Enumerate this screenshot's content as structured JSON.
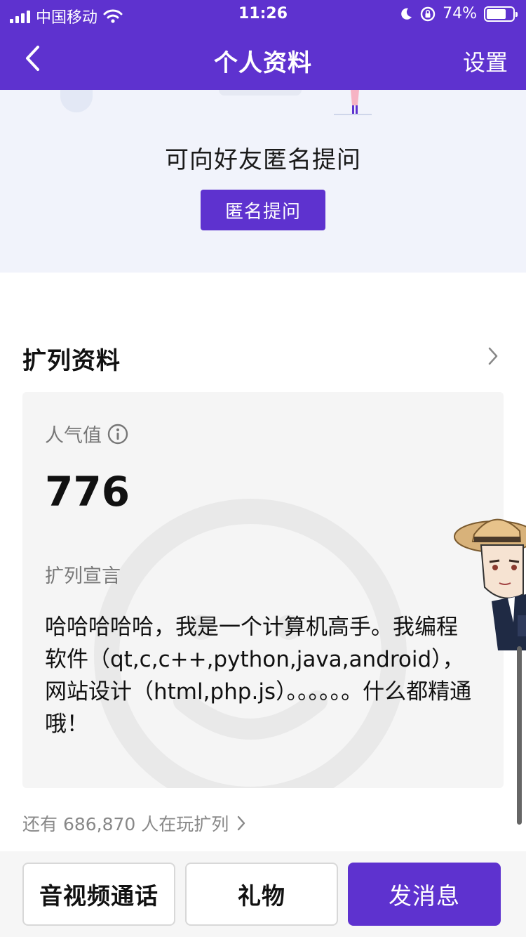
{
  "status_bar": {
    "carrier": "中国移动",
    "time": "11:26",
    "battery_percent": "74%",
    "battery_level": 0.74,
    "icons": [
      "signal-icon",
      "wifi-icon",
      "moon-icon",
      "orientation-lock-icon",
      "battery-icon"
    ]
  },
  "nav": {
    "back_icon": "chevron-left-icon",
    "title": "个人资料",
    "settings_label": "设置"
  },
  "anon_question": {
    "prompt": "可向好友匿名提问",
    "button_label": "匿名提问"
  },
  "profile": {
    "section_title": "扩列资料",
    "popularity_label": "人气值",
    "popularity_value": "776",
    "declaration_label": "扩列宣言",
    "declaration_text": "哈哈哈哈哈，我是一个计算机高手。我编程软件（qt,c,c++,python,java,android），网站设计（html,php.js）。。。。。。什么都精通哦！",
    "players_text": "还有 686,870 人在玩扩列"
  },
  "bottom_bar": {
    "call_label": "音视频通话",
    "gift_label": "礼物",
    "message_label": "发消息"
  },
  "colors": {
    "accent": "#5e32cf",
    "card_bg": "#f5f5f5",
    "banner_bg": "#f1f3fb"
  }
}
